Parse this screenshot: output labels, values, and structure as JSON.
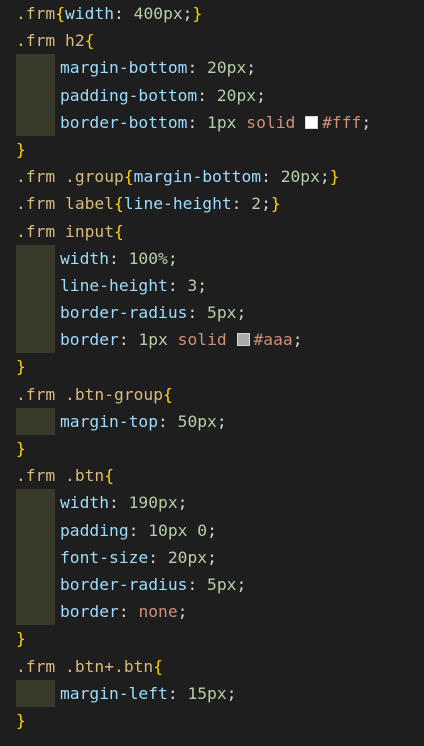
{
  "lines": [
    {
      "indent": false,
      "tokens": [
        {
          "t": ".frm",
          "c": "sel"
        },
        {
          "t": "{",
          "c": "brace"
        },
        {
          "t": "width",
          "c": "prop"
        },
        {
          "t": ": ",
          "c": "punct"
        },
        {
          "t": "400px",
          "c": "num"
        },
        {
          "t": ";",
          "c": "punct"
        },
        {
          "t": "}",
          "c": "brace"
        }
      ]
    },
    {
      "indent": false,
      "tokens": [
        {
          "t": ".frm h2",
          "c": "sel"
        },
        {
          "t": "{",
          "c": "brace"
        }
      ]
    },
    {
      "indent": true,
      "tokens": [
        {
          "t": "margin-bottom",
          "c": "prop"
        },
        {
          "t": ": ",
          "c": "punct"
        },
        {
          "t": "20px",
          "c": "num"
        },
        {
          "t": ";",
          "c": "punct"
        }
      ]
    },
    {
      "indent": true,
      "tokens": [
        {
          "t": "padding-bottom",
          "c": "prop"
        },
        {
          "t": ": ",
          "c": "punct"
        },
        {
          "t": "20px",
          "c": "num"
        },
        {
          "t": ";",
          "c": "punct"
        }
      ]
    },
    {
      "indent": true,
      "tokens": [
        {
          "t": "border-bottom",
          "c": "prop"
        },
        {
          "t": ": ",
          "c": "punct"
        },
        {
          "t": "1px",
          "c": "num"
        },
        {
          "t": " ",
          "c": "punct"
        },
        {
          "t": "solid",
          "c": "kw"
        },
        {
          "t": " ",
          "c": "punct"
        },
        {
          "swatch": "#ffffff"
        },
        {
          "t": "#fff",
          "c": "kw"
        },
        {
          "t": ";",
          "c": "punct"
        }
      ]
    },
    {
      "indent": false,
      "tokens": [
        {
          "t": "}",
          "c": "brace"
        }
      ]
    },
    {
      "indent": false,
      "tokens": [
        {
          "t": ".frm .group",
          "c": "sel"
        },
        {
          "t": "{",
          "c": "brace"
        },
        {
          "t": "margin-bottom",
          "c": "prop"
        },
        {
          "t": ": ",
          "c": "punct"
        },
        {
          "t": "20px",
          "c": "num"
        },
        {
          "t": ";",
          "c": "punct"
        },
        {
          "t": "}",
          "c": "brace"
        }
      ]
    },
    {
      "indent": false,
      "tokens": [
        {
          "t": ".frm label",
          "c": "sel"
        },
        {
          "t": "{",
          "c": "brace"
        },
        {
          "t": "line-height",
          "c": "prop"
        },
        {
          "t": ": ",
          "c": "punct"
        },
        {
          "t": "2",
          "c": "num"
        },
        {
          "t": ";",
          "c": "punct"
        },
        {
          "t": "}",
          "c": "brace"
        }
      ]
    },
    {
      "indent": false,
      "tokens": [
        {
          "t": ".frm input",
          "c": "sel"
        },
        {
          "t": "{",
          "c": "brace"
        }
      ]
    },
    {
      "indent": true,
      "tokens": [
        {
          "t": "width",
          "c": "prop"
        },
        {
          "t": ": ",
          "c": "punct"
        },
        {
          "t": "100%",
          "c": "num"
        },
        {
          "t": ";",
          "c": "punct"
        }
      ]
    },
    {
      "indent": true,
      "tokens": [
        {
          "t": "line-height",
          "c": "prop"
        },
        {
          "t": ": ",
          "c": "punct"
        },
        {
          "t": "3",
          "c": "num"
        },
        {
          "t": ";",
          "c": "punct"
        }
      ]
    },
    {
      "indent": true,
      "tokens": [
        {
          "t": "border-radius",
          "c": "prop"
        },
        {
          "t": ": ",
          "c": "punct"
        },
        {
          "t": "5px",
          "c": "num"
        },
        {
          "t": ";",
          "c": "punct"
        }
      ]
    },
    {
      "indent": true,
      "tokens": [
        {
          "t": "border",
          "c": "prop"
        },
        {
          "t": ": ",
          "c": "punct"
        },
        {
          "t": "1px",
          "c": "num"
        },
        {
          "t": " ",
          "c": "punct"
        },
        {
          "t": "solid",
          "c": "kw"
        },
        {
          "t": " ",
          "c": "punct"
        },
        {
          "swatch": "#aaaaaa"
        },
        {
          "t": "#aaa",
          "c": "kw"
        },
        {
          "t": ";",
          "c": "punct"
        }
      ]
    },
    {
      "indent": false,
      "tokens": [
        {
          "t": "}",
          "c": "brace"
        }
      ]
    },
    {
      "indent": false,
      "tokens": [
        {
          "t": ".frm .btn-group",
          "c": "sel"
        },
        {
          "t": "{",
          "c": "brace"
        }
      ]
    },
    {
      "indent": true,
      "tokens": [
        {
          "t": "margin-top",
          "c": "prop"
        },
        {
          "t": ": ",
          "c": "punct"
        },
        {
          "t": "50px",
          "c": "num"
        },
        {
          "t": ";",
          "c": "punct"
        }
      ]
    },
    {
      "indent": false,
      "tokens": [
        {
          "t": "}",
          "c": "brace"
        }
      ]
    },
    {
      "indent": false,
      "tokens": [
        {
          "t": ".frm .btn",
          "c": "sel"
        },
        {
          "t": "{",
          "c": "brace"
        }
      ]
    },
    {
      "indent": true,
      "tokens": [
        {
          "t": "width",
          "c": "prop"
        },
        {
          "t": ": ",
          "c": "punct"
        },
        {
          "t": "190px",
          "c": "num"
        },
        {
          "t": ";",
          "c": "punct"
        }
      ]
    },
    {
      "indent": true,
      "tokens": [
        {
          "t": "padding",
          "c": "prop"
        },
        {
          "t": ": ",
          "c": "punct"
        },
        {
          "t": "10px 0",
          "c": "num"
        },
        {
          "t": ";",
          "c": "punct"
        }
      ]
    },
    {
      "indent": true,
      "tokens": [
        {
          "t": "font-size",
          "c": "prop"
        },
        {
          "t": ": ",
          "c": "punct"
        },
        {
          "t": "20px",
          "c": "num"
        },
        {
          "t": ";",
          "c": "punct"
        }
      ]
    },
    {
      "indent": true,
      "tokens": [
        {
          "t": "border-radius",
          "c": "prop"
        },
        {
          "t": ": ",
          "c": "punct"
        },
        {
          "t": "5px",
          "c": "num"
        },
        {
          "t": ";",
          "c": "punct"
        }
      ]
    },
    {
      "indent": true,
      "tokens": [
        {
          "t": "border",
          "c": "prop"
        },
        {
          "t": ": ",
          "c": "punct"
        },
        {
          "t": "none",
          "c": "kw"
        },
        {
          "t": ";",
          "c": "punct"
        }
      ]
    },
    {
      "indent": false,
      "tokens": [
        {
          "t": "}",
          "c": "brace"
        }
      ]
    },
    {
      "indent": false,
      "tokens": [
        {
          "t": ".frm .btn+.btn",
          "c": "sel"
        },
        {
          "t": "{",
          "c": "brace"
        }
      ]
    },
    {
      "indent": true,
      "tokens": [
        {
          "t": "margin-left",
          "c": "prop"
        },
        {
          "t": ": ",
          "c": "punct"
        },
        {
          "t": "15px",
          "c": "num"
        },
        {
          "t": ";",
          "c": "punct"
        }
      ]
    },
    {
      "indent": false,
      "tokens": [
        {
          "t": "}",
          "c": "brace"
        }
      ]
    }
  ]
}
